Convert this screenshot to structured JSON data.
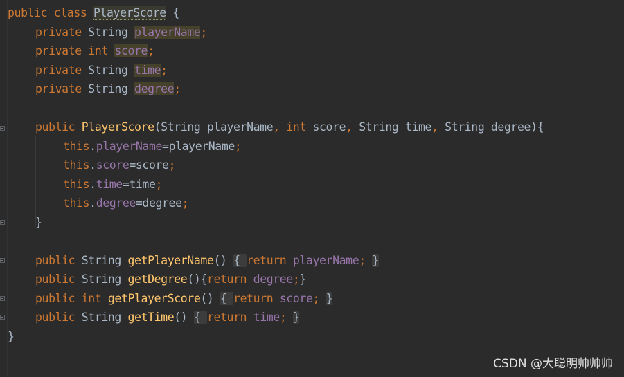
{
  "watermark": "CSDN @大聪明帅帅帅",
  "colors": {
    "background": "#2b2b2b",
    "keyword": "#cc7832",
    "field": "#9876aa",
    "method": "#ffc66d",
    "text": "#a9b7c6",
    "usage_highlight": "#45412b"
  },
  "code_lines": [
    {
      "tokens": [
        {
          "t": "public class ",
          "c": "kw"
        },
        {
          "t": "PlayerScore",
          "c": "plain",
          "x": "hl-cls",
          "caret": true
        },
        {
          "t": " {",
          "c": "plain"
        }
      ]
    },
    {
      "tokens": [
        {
          "t": "private ",
          "c": "kw"
        },
        {
          "t": "String ",
          "c": "plain"
        },
        {
          "t": "playerName",
          "c": "fld",
          "x": "hl"
        },
        {
          "t": ";",
          "c": "kw"
        }
      ]
    },
    {
      "tokens": [
        {
          "t": "private ",
          "c": "kw"
        },
        {
          "t": "int ",
          "c": "kw"
        },
        {
          "t": "score",
          "c": "fld",
          "x": "hl"
        },
        {
          "t": ";",
          "c": "kw"
        }
      ]
    },
    {
      "tokens": [
        {
          "t": "private ",
          "c": "kw"
        },
        {
          "t": "String ",
          "c": "plain"
        },
        {
          "t": "time",
          "c": "fld",
          "x": "hl"
        },
        {
          "t": ";",
          "c": "kw"
        }
      ]
    },
    {
      "tokens": [
        {
          "t": "private ",
          "c": "kw"
        },
        {
          "t": "String ",
          "c": "plain"
        },
        {
          "t": "degree",
          "c": "fld",
          "x": "hl"
        },
        {
          "t": ";",
          "c": "kw"
        }
      ]
    },
    {
      "tokens": []
    },
    {
      "tokens": [
        {
          "t": "public ",
          "c": "kw"
        },
        {
          "t": "PlayerScore",
          "c": "meth"
        },
        {
          "t": "(String playerName",
          "c": "plain"
        },
        {
          "t": ", ",
          "c": "kw"
        },
        {
          "t": "int ",
          "c": "kw"
        },
        {
          "t": "score",
          "c": "plain"
        },
        {
          "t": ", ",
          "c": "kw"
        },
        {
          "t": "String time",
          "c": "plain"
        },
        {
          "t": ", ",
          "c": "kw"
        },
        {
          "t": "String degree){",
          "c": "plain"
        }
      ]
    },
    {
      "tokens": [
        {
          "t": "this",
          "c": "kw"
        },
        {
          "t": ".",
          "c": "plain"
        },
        {
          "t": "playerName",
          "c": "fld"
        },
        {
          "t": "=playerName",
          "c": "plain"
        },
        {
          "t": ";",
          "c": "kw"
        }
      ]
    },
    {
      "tokens": [
        {
          "t": "this",
          "c": "kw"
        },
        {
          "t": ".",
          "c": "plain"
        },
        {
          "t": "score",
          "c": "fld"
        },
        {
          "t": "=score",
          "c": "plain"
        },
        {
          "t": ";",
          "c": "kw"
        }
      ]
    },
    {
      "tokens": [
        {
          "t": "this",
          "c": "kw"
        },
        {
          "t": ".",
          "c": "plain"
        },
        {
          "t": "time",
          "c": "fld"
        },
        {
          "t": "=time",
          "c": "plain"
        },
        {
          "t": ";",
          "c": "kw"
        }
      ]
    },
    {
      "tokens": [
        {
          "t": "this",
          "c": "kw"
        },
        {
          "t": ".",
          "c": "plain"
        },
        {
          "t": "degree",
          "c": "fld"
        },
        {
          "t": "=degree",
          "c": "plain"
        },
        {
          "t": ";",
          "c": "kw"
        }
      ]
    },
    {
      "tokens": [
        {
          "t": "}",
          "c": "plain"
        }
      ]
    },
    {
      "tokens": []
    },
    {
      "tokens": [
        {
          "t": "public ",
          "c": "kw"
        },
        {
          "t": "String ",
          "c": "plain"
        },
        {
          "t": "getPlayerName",
          "c": "meth"
        },
        {
          "t": "() ",
          "c": "plain"
        },
        {
          "t": "{ ",
          "c": "plain",
          "x": "cbox"
        },
        {
          "t": "return ",
          "c": "kw"
        },
        {
          "t": "playerName",
          "c": "fld"
        },
        {
          "t": "; ",
          "c": "kw"
        },
        {
          "t": "}",
          "c": "plain",
          "x": "cbox"
        }
      ]
    },
    {
      "tokens": [
        {
          "t": "public ",
          "c": "kw"
        },
        {
          "t": "String ",
          "c": "plain"
        },
        {
          "t": "getDegree",
          "c": "meth"
        },
        {
          "t": "(){",
          "c": "plain"
        },
        {
          "t": "return ",
          "c": "kw"
        },
        {
          "t": "degree",
          "c": "fld"
        },
        {
          "t": ";",
          "c": "kw"
        },
        {
          "t": "}",
          "c": "plain"
        }
      ]
    },
    {
      "tokens": [
        {
          "t": "public ",
          "c": "kw"
        },
        {
          "t": "int ",
          "c": "kw"
        },
        {
          "t": "getPlayerScore",
          "c": "meth"
        },
        {
          "t": "() ",
          "c": "plain"
        },
        {
          "t": "{ ",
          "c": "plain",
          "x": "cbox"
        },
        {
          "t": "return ",
          "c": "kw"
        },
        {
          "t": "score",
          "c": "fld"
        },
        {
          "t": "; ",
          "c": "kw"
        },
        {
          "t": "}",
          "c": "plain",
          "x": "cbox"
        }
      ]
    },
    {
      "tokens": [
        {
          "t": "public ",
          "c": "kw"
        },
        {
          "t": "String ",
          "c": "plain"
        },
        {
          "t": "getTime",
          "c": "meth"
        },
        {
          "t": "() ",
          "c": "plain"
        },
        {
          "t": "{ ",
          "c": "plain",
          "x": "cbox"
        },
        {
          "t": "return ",
          "c": "kw"
        },
        {
          "t": "time",
          "c": "fld"
        },
        {
          "t": "; ",
          "c": "kw"
        },
        {
          "t": "}",
          "c": "plain",
          "x": "cbox"
        }
      ]
    },
    {
      "tokens": [
        {
          "t": "}",
          "c": "plain"
        }
      ]
    }
  ]
}
